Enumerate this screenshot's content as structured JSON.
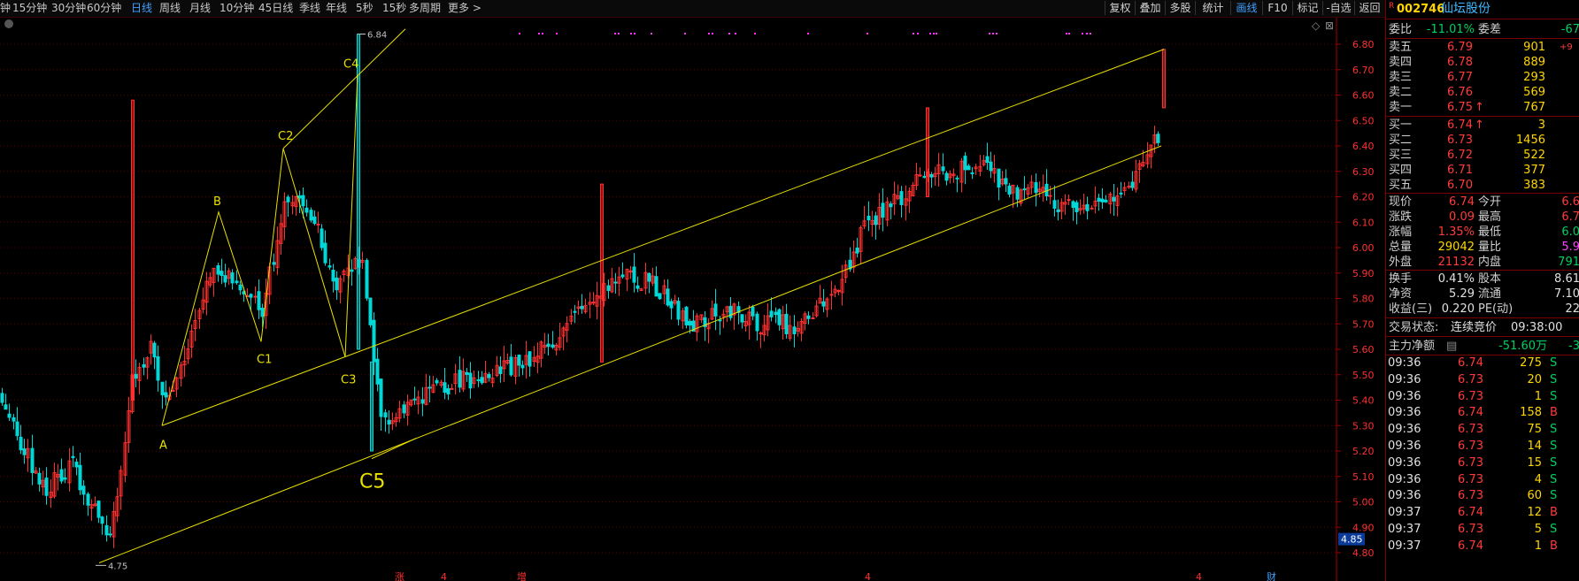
{
  "toolbar": {
    "periods": [
      {
        "label": "钟",
        "active": false
      },
      {
        "label": "15分钟",
        "active": false
      },
      {
        "label": "30分钟",
        "active": false
      },
      {
        "label": "60分钟",
        "active": false
      },
      {
        "label": "日线",
        "active": true
      },
      {
        "label": "周线",
        "active": false
      },
      {
        "label": "月线",
        "active": false
      },
      {
        "label": "10分钟",
        "active": false
      },
      {
        "label": "45日线",
        "active": false
      },
      {
        "label": "季线",
        "active": false
      },
      {
        "label": "年线",
        "active": false
      },
      {
        "label": "5秒",
        "active": false
      },
      {
        "label": "15秒",
        "active": false
      },
      {
        "label": "多周期",
        "active": false
      },
      {
        "label": "更多 >",
        "active": false
      }
    ],
    "buttons": [
      {
        "label": "复权",
        "active": false
      },
      {
        "label": "叠加",
        "active": false
      },
      {
        "label": "多股",
        "active": false
      },
      {
        "label": "统计",
        "active": false
      },
      {
        "label": "画线",
        "active": true
      },
      {
        "label": "F10",
        "active": false
      },
      {
        "label": "标记",
        "active": false
      },
      {
        "label": "-自选",
        "active": false
      },
      {
        "label": "返回",
        "active": false
      }
    ]
  },
  "stock": {
    "badge": "R",
    "code": "002746",
    "name": "仙坛股份"
  },
  "quote": {
    "weibi_label": "委比",
    "weibi": "-11.01%",
    "weicha_label": "委差",
    "weicha": "-67",
    "sell": [
      {
        "label": "卖五",
        "price": "6.79",
        "vol": "901",
        "extra": "+9"
      },
      {
        "label": "卖四",
        "price": "6.78",
        "vol": "889",
        "extra": ""
      },
      {
        "label": "卖三",
        "price": "6.77",
        "vol": "293",
        "extra": ""
      },
      {
        "label": "卖二",
        "price": "6.76",
        "vol": "569",
        "extra": ""
      },
      {
        "label": "卖一",
        "price": "6.75",
        "arrow": "↑",
        "vol": "767",
        "extra": ""
      }
    ],
    "buy": [
      {
        "label": "买一",
        "price": "6.74",
        "arrow": "↑",
        "vol": "3"
      },
      {
        "label": "买二",
        "price": "6.73",
        "vol": "1456"
      },
      {
        "label": "买三",
        "price": "6.72",
        "vol": "522"
      },
      {
        "label": "买四",
        "price": "6.71",
        "vol": "377"
      },
      {
        "label": "买五",
        "price": "6.70",
        "vol": "383"
      }
    ],
    "stats": [
      {
        "l1": "现价",
        "v1": "6.74",
        "c1": "red",
        "l2": "今开",
        "v2": "6.6",
        "c2": "red"
      },
      {
        "l1": "涨跌",
        "v1": "0.09",
        "c1": "red",
        "l2": "最高",
        "v2": "6.7",
        "c2": "red"
      },
      {
        "l1": "涨幅",
        "v1": "1.35%",
        "c1": "red",
        "l2": "最低",
        "v2": "6.0",
        "c2": "green"
      },
      {
        "l1": "总量",
        "v1": "29042",
        "c1": "yellow",
        "l2": "量比",
        "v2": "5.9",
        "c2": "pink"
      },
      {
        "l1": "外盘",
        "v1": "21132",
        "c1": "red",
        "l2": "内盘",
        "v2": "791",
        "c2": "green"
      }
    ],
    "stats2": [
      {
        "l1": "换手",
        "v1": "0.41%",
        "l2": "股本",
        "v2": "8.61"
      },
      {
        "l1": "净资",
        "v1": "5.29",
        "l2": "流通",
        "v2": "7.10"
      },
      {
        "l1": "收益(三)",
        "v1": "0.220",
        "l2": "PE(动)",
        "v2": "22"
      }
    ],
    "trade_state_label": "交易状态:",
    "trade_state": "连续竞价",
    "trade_time": "09:38:00",
    "mainflow_label": "主力净额",
    "mainflow": "-51.60万",
    "mainflow_extra": "-3"
  },
  "ticks": [
    {
      "t": "09:36",
      "p": "6.74",
      "v": "275",
      "s": "S",
      "pc": "red"
    },
    {
      "t": "09:36",
      "p": "6.73",
      "v": "20",
      "s": "S",
      "pc": "red"
    },
    {
      "t": "09:36",
      "p": "6.73",
      "v": "1",
      "s": "S",
      "pc": "red"
    },
    {
      "t": "09:36",
      "p": "6.74",
      "v": "158",
      "s": "B",
      "pc": "red"
    },
    {
      "t": "09:36",
      "p": "6.73",
      "v": "75",
      "s": "S",
      "pc": "red"
    },
    {
      "t": "09:36",
      "p": "6.73",
      "v": "14",
      "s": "S",
      "pc": "red"
    },
    {
      "t": "09:36",
      "p": "6.73",
      "v": "15",
      "s": "S",
      "pc": "red"
    },
    {
      "t": "09:36",
      "p": "6.73",
      "v": "4",
      "s": "S",
      "pc": "red"
    },
    {
      "t": "09:36",
      "p": "6.73",
      "v": "60",
      "s": "S",
      "pc": "red"
    },
    {
      "t": "09:37",
      "p": "6.74",
      "v": "12",
      "s": "B",
      "pc": "red"
    },
    {
      "t": "09:37",
      "p": "6.73",
      "v": "5",
      "s": "S",
      "pc": "red"
    },
    {
      "t": "09:37",
      "p": "6.74",
      "v": "1",
      "s": "B",
      "pc": "red"
    }
  ],
  "chart_data": {
    "type": "candlestick",
    "y_ticks": [
      "6.80",
      "6.70",
      "6.60",
      "6.50",
      "6.40",
      "6.30",
      "6.20",
      "6.10",
      "6.00",
      "5.90",
      "5.80",
      "5.70",
      "5.60",
      "5.50",
      "5.40",
      "5.30",
      "5.20",
      "5.10",
      "5.00",
      "4.90",
      "4.80"
    ],
    "ylim": [
      4.75,
      6.86
    ],
    "current_price_marker": "4.85",
    "high_label": "6.84",
    "low_label": "4.75",
    "wave_labels": [
      "A",
      "B",
      "C1",
      "C2",
      "C3",
      "C4",
      "C5"
    ],
    "bottom_markers": [
      "涨",
      "4",
      "增",
      "4",
      "4",
      "财"
    ],
    "colors": {
      "up": "#ff3030",
      "down": "#00d8d8",
      "trend": "#e8e000",
      "label": "#e8e000",
      "grid": "#5a0000",
      "marker": "#ff30ff"
    }
  }
}
